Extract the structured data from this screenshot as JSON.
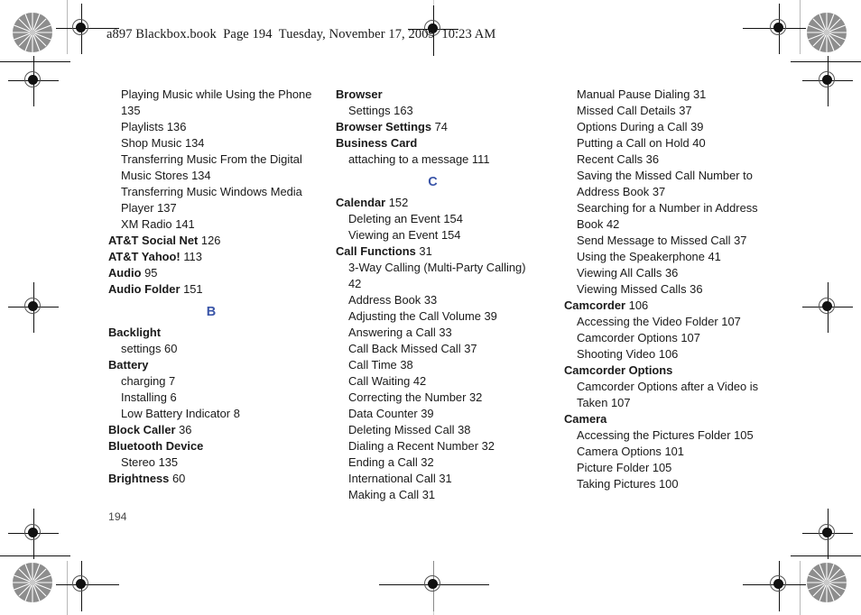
{
  "header": {
    "text": "a897 Blackbox.book  Page 194  Tuesday, November 17, 2009  10:23 AM"
  },
  "page_number": "194",
  "colors": {
    "letter_heading": "#3a55a8",
    "body_text": "#1a1a1a",
    "page_number": "#4a4a4a",
    "registration_mark": "#111111",
    "trim_line": "#b9b9b9",
    "star_target": "#8d8d8d"
  },
  "print_marks": {
    "star_targets": [
      "star-target-top-left",
      "star-target-top-right",
      "star-target-bottom-left",
      "star-target-bottom-right"
    ],
    "registration_marks": [
      "reg-mark-top-left",
      "reg-mark-top-right",
      "reg-mark-top-center",
      "reg-mark-left-upper",
      "reg-mark-right-upper",
      "reg-mark-left-middle",
      "reg-mark-right-middle",
      "reg-mark-left-lower",
      "reg-mark-right-lower",
      "reg-mark-bottom-left",
      "reg-mark-bottom-right",
      "reg-mark-bottom-center"
    ]
  },
  "columns": [
    {
      "id": "column-1",
      "blocks": [
        {
          "letter": null,
          "entries": [
            {
              "type": "sub",
              "label": "Playing Music while Using the Phone",
              "page": "",
              "wrap": false
            },
            {
              "type": "sub",
              "label": "135",
              "page": "",
              "wrap": true,
              "continuation": true
            },
            {
              "type": "sub",
              "label": "Playlists",
              "page": "136",
              "wrap": false
            },
            {
              "type": "sub",
              "label": "Shop Music",
              "page": "134",
              "wrap": false
            },
            {
              "type": "sub",
              "label": "Transferring Music From the Digital",
              "page": "",
              "wrap": false
            },
            {
              "type": "sub",
              "label": "Music Stores",
              "page": "134",
              "wrap": true,
              "continuation": true
            },
            {
              "type": "sub",
              "label": "Transferring Music Windows Media",
              "page": "",
              "wrap": false
            },
            {
              "type": "sub",
              "label": "Player",
              "page": "137",
              "wrap": true,
              "continuation": true
            },
            {
              "type": "sub",
              "label": "XM Radio",
              "page": "141",
              "wrap": false
            },
            {
              "type": "main",
              "label": "AT&T Social Net",
              "page": "126",
              "wrap": false
            },
            {
              "type": "main",
              "label": "AT&T Yahoo!",
              "page": "113",
              "wrap": false
            },
            {
              "type": "main",
              "label": "Audio",
              "page": "95",
              "wrap": false
            },
            {
              "type": "main",
              "label": "Audio Folder",
              "page": "151",
              "wrap": false
            }
          ]
        },
        {
          "letter": "B",
          "entries": [
            {
              "type": "main",
              "label": "Backlight",
              "page": "",
              "wrap": false
            },
            {
              "type": "sub",
              "label": "settings",
              "page": "60",
              "wrap": false
            },
            {
              "type": "main",
              "label": "Battery",
              "page": "",
              "wrap": false
            },
            {
              "type": "sub",
              "label": "charging",
              "page": "7",
              "wrap": false
            },
            {
              "type": "sub",
              "label": "Installing",
              "page": "6",
              "wrap": false
            },
            {
              "type": "sub",
              "label": "Low Battery Indicator",
              "page": "8",
              "wrap": false
            },
            {
              "type": "main",
              "label": "Block Caller",
              "page": "36",
              "wrap": false
            },
            {
              "type": "main",
              "label": "Bluetooth Device",
              "page": "",
              "wrap": false
            },
            {
              "type": "sub",
              "label": "Stereo",
              "page": "135",
              "wrap": false
            },
            {
              "type": "main",
              "label": "Brightness",
              "page": "60",
              "wrap": false
            }
          ]
        }
      ]
    },
    {
      "id": "column-2",
      "blocks": [
        {
          "letter": null,
          "entries": [
            {
              "type": "main",
              "label": "Browser",
              "page": "",
              "wrap": false
            },
            {
              "type": "sub",
              "label": "Settings",
              "page": "163",
              "wrap": false
            },
            {
              "type": "main",
              "label": "Browser Settings",
              "page": "74",
              "wrap": false
            },
            {
              "type": "main",
              "label": "Business Card",
              "page": "",
              "wrap": false
            },
            {
              "type": "sub",
              "label": "attaching to a message",
              "page": "111",
              "wrap": false
            }
          ]
        },
        {
          "letter": "C",
          "entries": [
            {
              "type": "main",
              "label": "Calendar",
              "page": "152",
              "wrap": false
            },
            {
              "type": "sub",
              "label": "Deleting an Event",
              "page": "154",
              "wrap": false
            },
            {
              "type": "sub",
              "label": "Viewing an Event",
              "page": "154",
              "wrap": false
            },
            {
              "type": "main",
              "label": "Call Functions",
              "page": "31",
              "wrap": false
            },
            {
              "type": "sub",
              "label": "3-Way Calling (Multi-Party Calling)",
              "page": "",
              "wrap": false
            },
            {
              "type": "sub",
              "label": "42",
              "page": "",
              "wrap": true,
              "continuation": true
            },
            {
              "type": "sub",
              "label": "Address Book",
              "page": "33",
              "wrap": false
            },
            {
              "type": "sub",
              "label": "Adjusting the Call Volume",
              "page": "39",
              "wrap": false
            },
            {
              "type": "sub",
              "label": "Answering a Call",
              "page": "33",
              "wrap": false
            },
            {
              "type": "sub",
              "label": "Call Back Missed Call",
              "page": "37",
              "wrap": false
            },
            {
              "type": "sub",
              "label": "Call Time",
              "page": "38",
              "wrap": false
            },
            {
              "type": "sub",
              "label": "Call Waiting",
              "page": "42",
              "wrap": false
            },
            {
              "type": "sub",
              "label": "Correcting the Number",
              "page": "32",
              "wrap": false
            },
            {
              "type": "sub",
              "label": "Data Counter",
              "page": "39",
              "wrap": false
            },
            {
              "type": "sub",
              "label": "Deleting Missed Call",
              "page": "38",
              "wrap": false
            },
            {
              "type": "sub",
              "label": "Dialing a Recent Number",
              "page": "32",
              "wrap": false
            },
            {
              "type": "sub",
              "label": "Ending a Call",
              "page": "32",
              "wrap": false
            },
            {
              "type": "sub",
              "label": "International Call",
              "page": "31",
              "wrap": false
            },
            {
              "type": "sub",
              "label": "Making a Call",
              "page": "31",
              "wrap": false
            }
          ]
        }
      ]
    },
    {
      "id": "column-3",
      "blocks": [
        {
          "letter": null,
          "entries": [
            {
              "type": "sub",
              "label": "Manual Pause Dialing",
              "page": "31",
              "wrap": false
            },
            {
              "type": "sub",
              "label": "Missed Call Details",
              "page": "37",
              "wrap": false
            },
            {
              "type": "sub",
              "label": "Options During a Call",
              "page": "39",
              "wrap": false
            },
            {
              "type": "sub",
              "label": "Putting a Call on Hold",
              "page": "40",
              "wrap": false
            },
            {
              "type": "sub",
              "label": "Recent Calls",
              "page": "36",
              "wrap": false
            },
            {
              "type": "sub",
              "label": "Saving the Missed Call Number to",
              "page": "",
              "wrap": false
            },
            {
              "type": "sub",
              "label": "Address Book",
              "page": "37",
              "wrap": true,
              "continuation": true
            },
            {
              "type": "sub",
              "label": "Searching for a Number in Address",
              "page": "",
              "wrap": false
            },
            {
              "type": "sub",
              "label": "Book",
              "page": "42",
              "wrap": true,
              "continuation": true
            },
            {
              "type": "sub",
              "label": "Send Message to Missed Call",
              "page": "37",
              "wrap": false
            },
            {
              "type": "sub",
              "label": "Using the Speakerphone",
              "page": "41",
              "wrap": false
            },
            {
              "type": "sub",
              "label": "Viewing All Calls",
              "page": "36",
              "wrap": false
            },
            {
              "type": "sub",
              "label": "Viewing Missed Calls",
              "page": "36",
              "wrap": false
            },
            {
              "type": "main",
              "label": "Camcorder",
              "page": "106",
              "wrap": false
            },
            {
              "type": "sub",
              "label": "Accessing the Video Folder",
              "page": "107",
              "wrap": false
            },
            {
              "type": "sub",
              "label": "Camcorder Options",
              "page": "107",
              "wrap": false
            },
            {
              "type": "sub",
              "label": "Shooting Video",
              "page": "106",
              "wrap": false
            },
            {
              "type": "main",
              "label": "Camcorder Options",
              "page": "",
              "wrap": false
            },
            {
              "type": "sub",
              "label": "Camcorder Options after a Video is",
              "page": "",
              "wrap": false
            },
            {
              "type": "sub",
              "label": "Taken",
              "page": "107",
              "wrap": true,
              "continuation": true
            },
            {
              "type": "main",
              "label": "Camera",
              "page": "",
              "wrap": false
            },
            {
              "type": "sub",
              "label": "Accessing the Pictures Folder",
              "page": "105",
              "wrap": false
            },
            {
              "type": "sub",
              "label": "Camera Options",
              "page": "101",
              "wrap": false
            },
            {
              "type": "sub",
              "label": "Picture Folder",
              "page": "105",
              "wrap": false
            },
            {
              "type": "sub",
              "label": "Taking Pictures",
              "page": "100",
              "wrap": false
            }
          ]
        }
      ]
    }
  ]
}
